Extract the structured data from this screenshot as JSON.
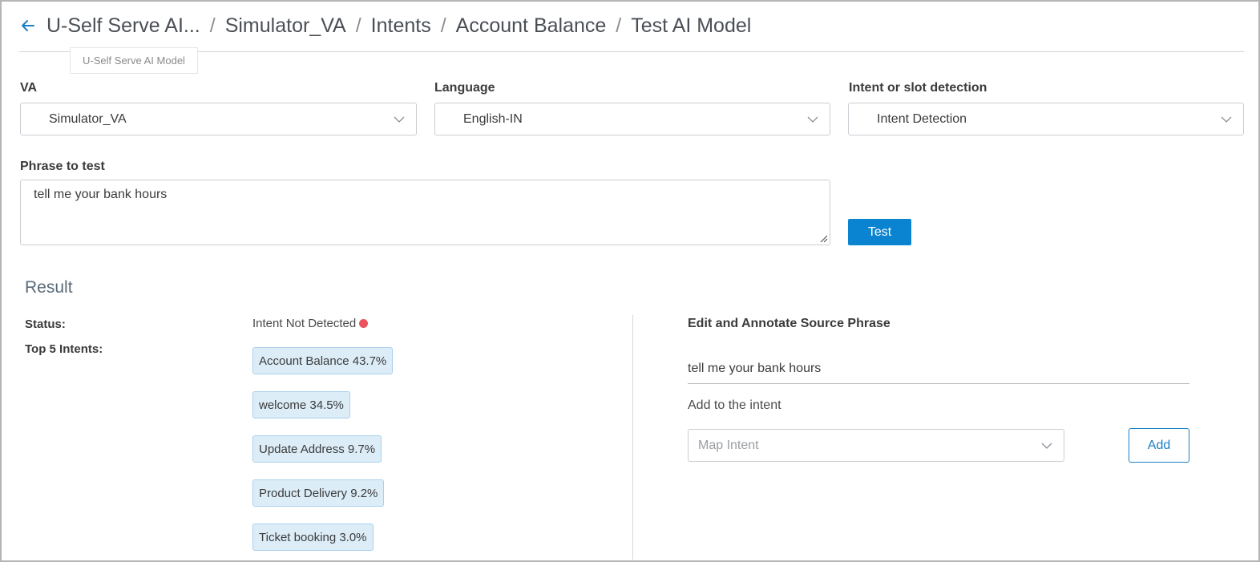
{
  "header": {
    "back_icon": "arrow-left-icon",
    "breadcrumbs": [
      "U-Self Serve AI...",
      "Simulator_VA",
      "Intents",
      "Account Balance",
      "Test AI Model"
    ],
    "separator": "/",
    "tooltip": "U-Self Serve AI Model"
  },
  "form": {
    "va": {
      "label": "VA",
      "value": "Simulator_VA"
    },
    "language": {
      "label": "Language",
      "value": "English-IN"
    },
    "detection": {
      "label": "Intent or slot detection",
      "value": "Intent Detection"
    },
    "phrase": {
      "label": "Phrase to test",
      "value": "tell me your bank hours"
    },
    "test_button": "Test"
  },
  "result": {
    "title": "Result",
    "status_label": "Status:",
    "status_value": "Intent Not Detected",
    "status_color": "#e9545e",
    "top_label": "Top 5 Intents:",
    "intents": [
      "Account Balance 43.7%",
      "welcome 34.5%",
      "Update Address 9.7%",
      "Product Delivery 9.2%",
      "Ticket booking 3.0%"
    ]
  },
  "annotate": {
    "title": "Edit and Annotate Source Phrase",
    "source_phrase": "tell me your bank hours",
    "add_label": "Add to the intent",
    "map_placeholder": "Map Intent",
    "add_button": "Add"
  },
  "colors": {
    "accent": "#0a84d1",
    "chip_bg": "#dcedf8",
    "chip_border": "#a9d0ec"
  }
}
